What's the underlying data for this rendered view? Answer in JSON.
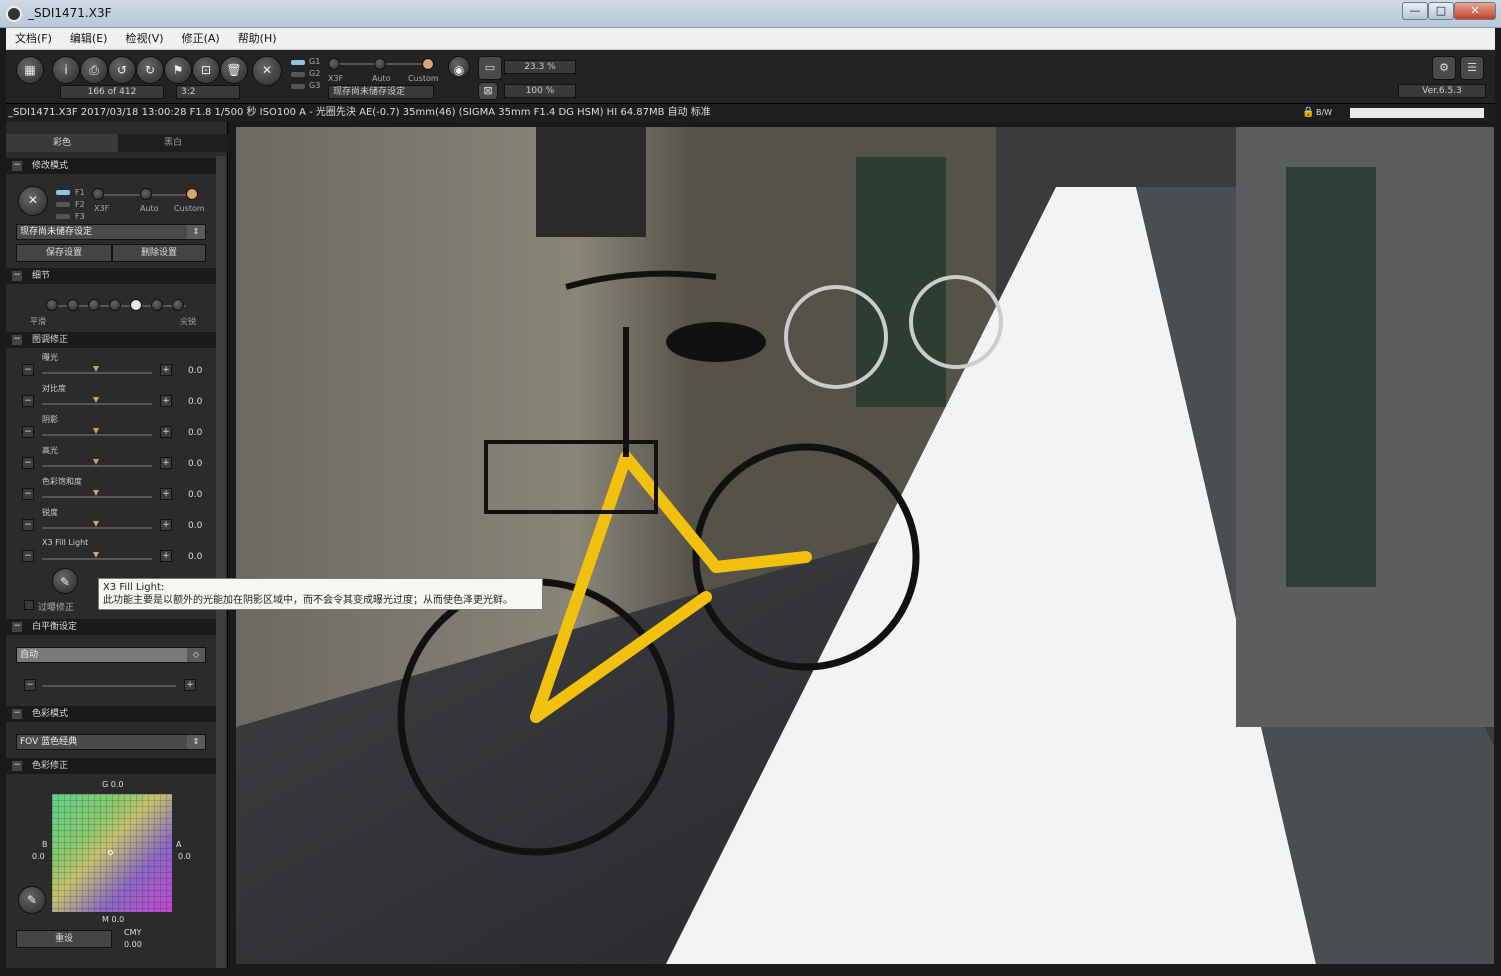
{
  "window": {
    "title": "_SDI1471.X3F",
    "min": "—",
    "max": "□",
    "close": "✕"
  },
  "menu": [
    "文档(F)",
    "编辑(E)",
    "检视(V)",
    "修正(A)",
    "帮助(H)"
  ],
  "toolbar": {
    "counter": "166 of 412",
    "aspect": "3:2",
    "modes": [
      "G1",
      "G2",
      "G3"
    ],
    "style_labels": [
      "X3F",
      "Auto",
      "Custom"
    ],
    "preset": "现存尚未储存设定",
    "zoom1": "23.3 %",
    "zoom2": "100 %",
    "version": "Ver.6.5.3"
  },
  "info": {
    "line": "_SDI1471.X3F 2017/03/18 13:00:28 F1.8 1/500 秒 ISO100 A - 光圈先決 AE(-0.7) 35mm(46) (SIGMA 35mm F1.4 DG HSM) HI 64.87MB 自动 标准",
    "bw": "B/W"
  },
  "sidebar": {
    "tabs": [
      "彩色",
      "黑白"
    ],
    "mode_section": "修改模式",
    "mode_bars": [
      "F1",
      "F2",
      "F3"
    ],
    "mode_labels": [
      "X3F",
      "Auto",
      "Custom"
    ],
    "preset_select": "现存尚未储存设定",
    "save_btn": "保存设置",
    "delete_btn": "删除设置",
    "detail_section": "细节",
    "detail_left": "平滑",
    "detail_right": "尖锐",
    "adjust_section": "图调修正",
    "sliders": [
      {
        "label": "曝光",
        "value": "0.0"
      },
      {
        "label": "对比度",
        "value": "0.0"
      },
      {
        "label": "阴影",
        "value": "0.0"
      },
      {
        "label": "高光",
        "value": "0.0"
      },
      {
        "label": "色彩饱和度",
        "value": "0.0"
      },
      {
        "label": "锐度",
        "value": "0.0"
      },
      {
        "label": "X3 Fill Light",
        "value": "0.0"
      }
    ],
    "highlight_check": "过曝修正",
    "wb_section": "白平衡设定",
    "wb_select": "自动",
    "color_mode_section": "色彩模式",
    "color_mode_select": "FOV 蓝色经典",
    "color_adjust_section": "色彩修正",
    "grid_top": "G 0.0",
    "grid_bottom": "M 0.0",
    "grid_left_label": "B",
    "grid_left_value": "0.0",
    "grid_right_label": "A",
    "grid_right_value": "0.0",
    "reset_btn": "重设",
    "cmy_label": "CMY",
    "cmy_value": "0.00"
  },
  "tooltip": {
    "title": "X3 Fill Light:",
    "body": "此功能主要是以额外的光能加在阴影区域中，而不会令其变成曝光过度；从而使色泽更光鲜。"
  }
}
